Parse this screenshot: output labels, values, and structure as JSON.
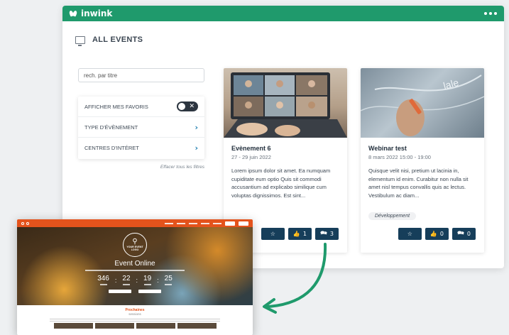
{
  "app": {
    "brand": "inwink",
    "brand_color": "#1f9a6c",
    "accent_dark": "#163e5a",
    "preview_accent": "#e4531c"
  },
  "page": {
    "title": "ALL EVENTS"
  },
  "filters": {
    "search_placeholder": "rech. par titre",
    "favorites_label": "AFFICHER MES FAVORIS",
    "favorites_toggle_on": false,
    "event_type_label": "TYPE D'ÉVÈNEMENT",
    "interests_label": "CENTRES D'INTÉRET",
    "clear_label": "Effacer tous les filtres"
  },
  "cards": [
    {
      "title": "Evènement 6",
      "date": "27 - 29 juin 2022",
      "description": "Lorem ipsum dolor sit amet. Ea numquam cupiditate eum optio Quis sit commodi accusantium ad explicabo similique cum voluptas dignissimos. Est sint...",
      "tag": "",
      "likes": "1",
      "comments": "3"
    },
    {
      "title": "Webinar test",
      "date": "8 mars 2022 15:00 - 19:00",
      "description": "Quisque velit nisi, pretium ut lacinia in, elementum id enim. Curabitur non nulla sit amet nisl tempus convallis quis ac lectus. Vestibulum ac diam...",
      "tag": "Développement",
      "likes": "0",
      "comments": "0"
    }
  ],
  "preview": {
    "logo_text": "YOUR EVENT LOGO",
    "event_title": "Event Online",
    "countdown": [
      "346",
      "22",
      "19",
      "25"
    ],
    "section_title": "Prochaines",
    "section_subtitle": "sessions"
  }
}
